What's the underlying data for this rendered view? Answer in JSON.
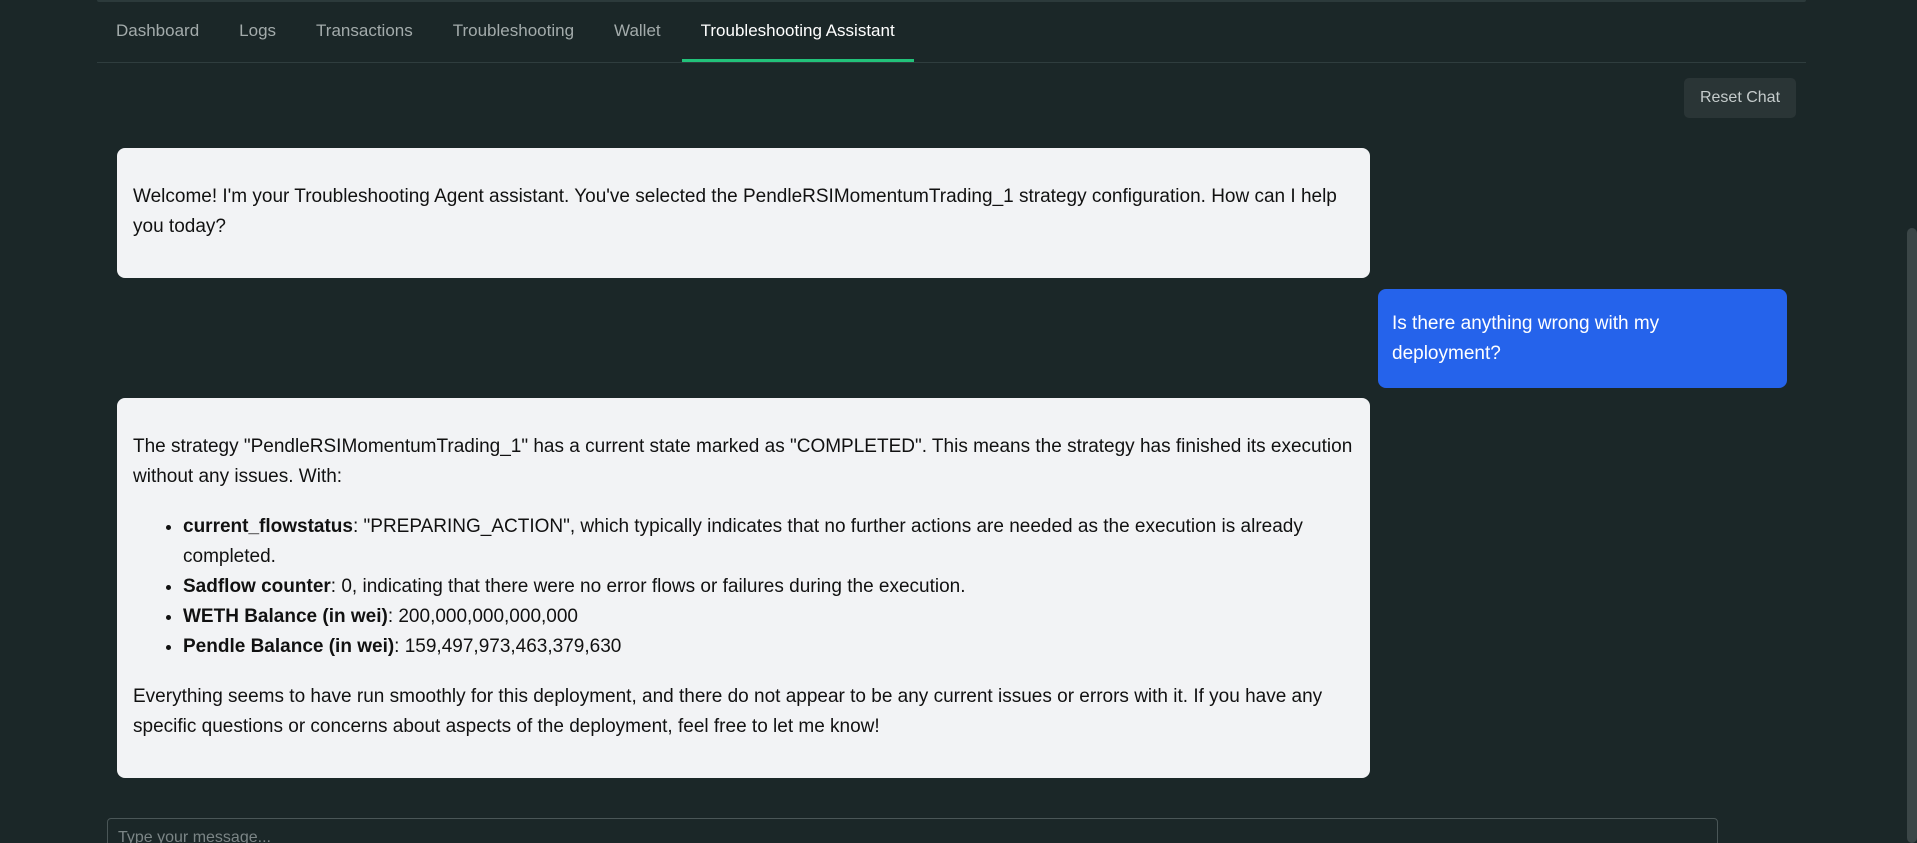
{
  "tabs": [
    {
      "label": "Dashboard"
    },
    {
      "label": "Logs"
    },
    {
      "label": "Transactions"
    },
    {
      "label": "Troubleshooting"
    },
    {
      "label": "Wallet"
    },
    {
      "label": "Troubleshooting Assistant",
      "active": true
    }
  ],
  "toolbar": {
    "reset_label": "Reset Chat"
  },
  "messages": {
    "welcome": "Welcome! I'm your Troubleshooting Agent assistant. You've selected the PendleRSIMomentumTrading_1 strategy configuration. How can I help you today?",
    "user_question": "Is there anything wrong with my deployment?",
    "reply": {
      "intro": "The strategy \"PendleRSIMomentumTrading_1\" has a current state marked as \"COMPLETED\". This means the strategy has finished its execution without any issues. With:",
      "items": [
        {
          "label": "current_flowstatus",
          "text": ": \"PREPARING_ACTION\", which typically indicates that no further actions are needed as the execution is already completed."
        },
        {
          "label": "Sadflow counter",
          "text": ": 0, indicating that there were no error flows or failures during the execution."
        },
        {
          "label": "WETH Balance (in wei)",
          "text": ": 200,000,000,000,000"
        },
        {
          "label": "Pendle Balance (in wei)",
          "text": ": 159,497,973,463,379,630"
        }
      ],
      "outro": "Everything seems to have run smoothly for this deployment, and there do not appear to be any current issues or errors with it. If you have any specific questions or concerns about aspects of the deployment, feel free to let me know!"
    }
  },
  "composer": {
    "placeholder": "Type your message..."
  },
  "colors": {
    "background": "#1b2728",
    "active_tab_underline": "#22c27a",
    "user_bubble": "#2563eb",
    "assistant_bubble": "#f2f3f5"
  }
}
